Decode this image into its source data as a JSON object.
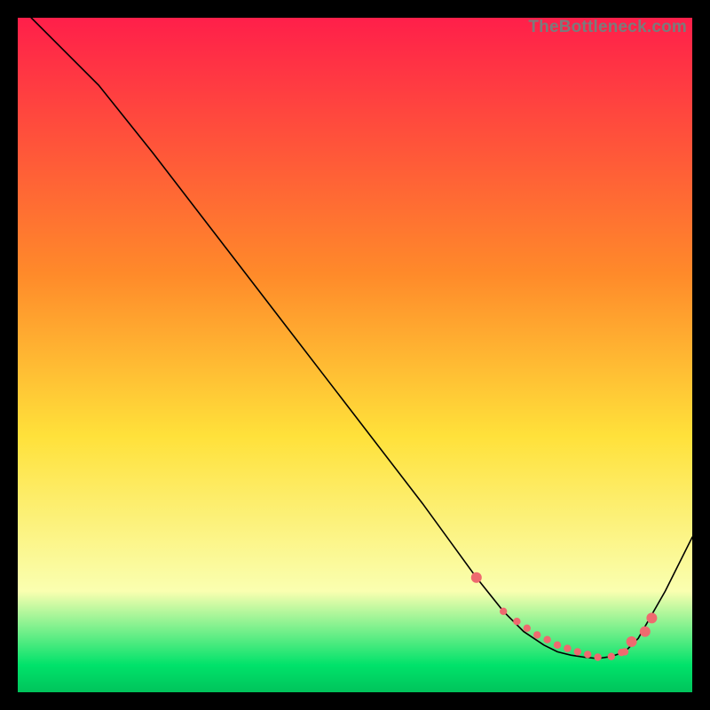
{
  "watermark": "TheBottleneck.com",
  "colors": {
    "gradient_top": "#ff1f4a",
    "gradient_yellow": "#ffe13a",
    "gradient_lightyellow": "#faffb0",
    "gradient_green": "#00e26a",
    "gradient_bottom": "#00c45b",
    "dot": "#ee6a6f",
    "curve": "#000000",
    "bg": "#000000"
  },
  "chart_data": {
    "type": "line",
    "title": "",
    "xlabel": "",
    "ylabel": "",
    "xlim": [
      0,
      100
    ],
    "ylim": [
      0,
      100
    ],
    "grid": false,
    "legend": false,
    "series": [
      {
        "name": "bottleneck-curve",
        "x": [
          2,
          6,
          12,
          20,
          30,
          40,
          50,
          60,
          68,
          72,
          75,
          78,
          80,
          82,
          84,
          86,
          88,
          90,
          92,
          96,
          100
        ],
        "y": [
          100,
          96,
          90,
          80,
          67,
          54,
          41,
          28,
          17,
          12,
          9,
          7,
          6,
          5.5,
          5.2,
          5,
          5.3,
          6,
          8,
          15,
          23
        ]
      }
    ],
    "highlight_dots": {
      "name": "bottom-dots",
      "x": [
        68,
        72,
        74,
        75.5,
        77,
        78.5,
        80,
        81.5,
        83,
        84.5,
        86,
        88,
        89.5,
        90,
        91
      ],
      "y": [
        17,
        12,
        10.5,
        9.5,
        8.5,
        7.8,
        7,
        6.5,
        6,
        5.6,
        5.2,
        5.3,
        5.9,
        6,
        7.5
      ]
    },
    "highlight_dots_right": {
      "name": "rising-dots",
      "x": [
        93,
        94
      ],
      "y": [
        9,
        11
      ]
    }
  }
}
